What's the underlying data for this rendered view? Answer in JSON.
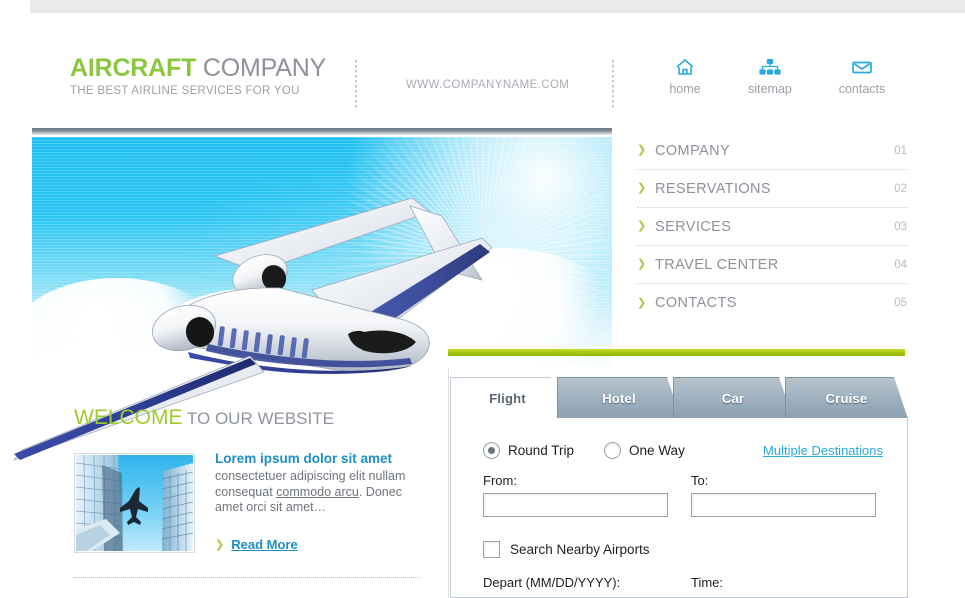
{
  "header": {
    "logo_primary": "AIRCRAFT",
    "logo_secondary": " COMPANY",
    "tagline": "THE BEST AIRLINE SERVICES FOR YOU",
    "site_url": "WWW.COMPANYNAME.COM",
    "separator": "⋮",
    "topnav": [
      {
        "label": "home",
        "icon": "home-icon"
      },
      {
        "label": "sitemap",
        "icon": "sitemap-icon"
      },
      {
        "label": "contacts",
        "icon": "envelope-icon"
      }
    ]
  },
  "hero": {
    "alt": "airplane-flying-in-blue-sky"
  },
  "right_menu": {
    "arrow": "❯",
    "items": [
      {
        "label": "COMPANY",
        "number": "01"
      },
      {
        "label": "RESERVATIONS",
        "number": "02"
      },
      {
        "label": "SERVICES",
        "number": "03"
      },
      {
        "label": "TRAVEL CENTER",
        "number": "04"
      },
      {
        "label": "CONTACTS",
        "number": "05"
      }
    ]
  },
  "welcome": {
    "title_primary": "WELCOME",
    "title_secondary": " TO OUR WEBSITE",
    "thumb_alt": "airplane-between-skyscrapers",
    "article_title": "Lorem ipsum dolor sit amet",
    "article_text_1": "consectetuer adipiscing elit nullam consequat ",
    "article_text_link": "commodo arcu",
    "article_text_2": ". Donec amet orci sit amet…",
    "read_more": "Read More",
    "read_more_arrow": "❯"
  },
  "booking": {
    "tabs": [
      {
        "label": "Flight",
        "active": true
      },
      {
        "label": "Hotel",
        "active": false
      },
      {
        "label": "Car",
        "active": false
      },
      {
        "label": "Cruise",
        "active": false
      }
    ],
    "trip_type": {
      "round_trip_label": "Round Trip",
      "one_way_label": "One Way",
      "selected": "Round Trip",
      "multiple_destinations_label": "Multiple Destinations"
    },
    "from_label": "From:",
    "from_value": "",
    "from_placeholder": "",
    "to_label": "To:",
    "to_value": "",
    "to_placeholder": "",
    "nearby_label": "Search Nearby Airports",
    "nearby_checked": false,
    "depart_label": "Depart (MM/DD/YYYY):",
    "time_label": "Time:"
  },
  "colors": {
    "brand_green": "#8cc63e",
    "accent_green": "#a7c913",
    "link_blue": "#1d8fc4",
    "icon_blue": "#29a9e0",
    "muted_gray": "#9aa0a8",
    "tab_gray": "#9dafbd"
  }
}
